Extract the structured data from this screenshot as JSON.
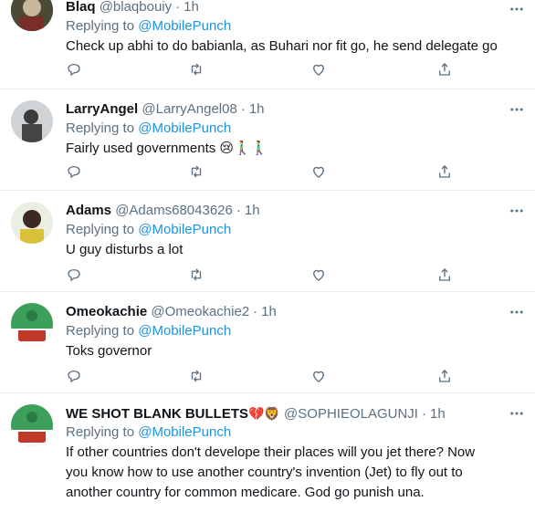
{
  "colors": {
    "mention": "#1b95e0",
    "secondary_text": "#5b7083",
    "divider": "#e6ecf0",
    "primary_text": "#0f1419"
  },
  "icons": [
    "more-icon",
    "reply-icon",
    "retweet-icon",
    "like-icon",
    "share-icon"
  ],
  "tweets": [
    {
      "name": "Blaq",
      "handle": "@blaqbouiy",
      "time": "1h",
      "replying_prefix": "Replying to",
      "replying_to": "@MobilePunch",
      "text": "Check up abhi to do babianla, as Buhari nor fit go, he send delegate go",
      "badges": ""
    },
    {
      "name": "LarryAngel",
      "handle": "@LarryAngel08",
      "time": "1h",
      "replying_prefix": "Replying to",
      "replying_to": "@MobilePunch",
      "text": "Fairly used governments 😢🚶‍♂️🚶‍♂️",
      "badges": ""
    },
    {
      "name": "Adams",
      "handle": "@Adams68043626",
      "time": "1h",
      "replying_prefix": "Replying to",
      "replying_to": "@MobilePunch",
      "text": "U guy disturbs a lot",
      "badges": ""
    },
    {
      "name": "Omeokachie",
      "handle": "@Omeokachie2",
      "time": "1h",
      "replying_prefix": "Replying to",
      "replying_to": "@MobilePunch",
      "text": "Toks governor",
      "badges": ""
    },
    {
      "name": "WE SHOT BLANK BULLETS",
      "handle": "@SOPHIEOLAGUNJI",
      "time": "1h",
      "replying_prefix": "Replying to",
      "replying_to": "@MobilePunch",
      "text": "If other countries don't develope their places will you jet there? Now you know how to use another country's invention (Jet) to fly out to another country for common medicare. God go punish una.",
      "badges": "💔🦁"
    }
  ]
}
